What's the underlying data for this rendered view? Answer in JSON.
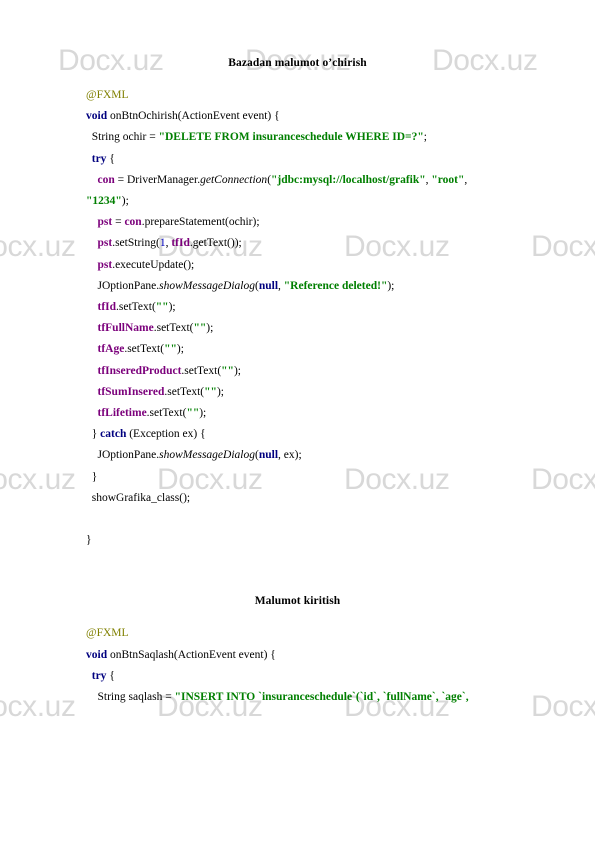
{
  "document": {
    "watermark_text": "Docx.uz",
    "watermark_color": "#d8d8d8",
    "colors": {
      "keyword": "#00007f",
      "annotation": "#808000",
      "string": "#007f00",
      "field": "#7b007b",
      "number": "#0000c0",
      "text": "#000000"
    }
  },
  "sections": [
    {
      "heading": "Bazadan malumot o’chirish",
      "lines": [
        {
          "indent": 0,
          "tokens": [
            {
              "t": "@FXML",
              "c": "anno"
            }
          ]
        },
        {
          "indent": 0,
          "tokens": [
            {
              "t": "void",
              "c": "kw"
            },
            {
              "t": " onBtnOchirish(ActionEvent event) {",
              "c": "pln"
            }
          ]
        },
        {
          "indent": 1,
          "tokens": [
            {
              "t": "String ochir = ",
              "c": "pln"
            },
            {
              "t": "\"DELETE FROM insuranceschedule WHERE ID=?\"",
              "c": "str"
            },
            {
              "t": ";",
              "c": "pln"
            }
          ]
        },
        {
          "indent": 1,
          "tokens": [
            {
              "t": "try",
              "c": "kw"
            },
            {
              "t": " {",
              "c": "pln"
            }
          ]
        },
        {
          "indent": 2,
          "tokens": [
            {
              "t": "con",
              "c": "fld"
            },
            {
              "t": " = DriverManager.",
              "c": "pln"
            },
            {
              "t": "getConnection",
              "c": "mth"
            },
            {
              "t": "(",
              "c": "pln"
            },
            {
              "t": "\"jdbc:mysql://localhost/grafik\"",
              "c": "str"
            },
            {
              "t": ", ",
              "c": "pln"
            },
            {
              "t": "\"root\"",
              "c": "str"
            },
            {
              "t": ",",
              "c": "pln"
            }
          ]
        },
        {
          "indent": 0,
          "tokens": [
            {
              "t": "\"1234\"",
              "c": "str"
            },
            {
              "t": ");",
              "c": "pln"
            }
          ]
        },
        {
          "indent": 2,
          "tokens": [
            {
              "t": "pst",
              "c": "fld"
            },
            {
              "t": " = ",
              "c": "pln"
            },
            {
              "t": "con",
              "c": "fld"
            },
            {
              "t": ".prepareStatement(ochir);",
              "c": "pln"
            }
          ]
        },
        {
          "indent": 2,
          "tokens": [
            {
              "t": "pst",
              "c": "fld"
            },
            {
              "t": ".setString(",
              "c": "pln"
            },
            {
              "t": "1",
              "c": "num"
            },
            {
              "t": ", ",
              "c": "pln"
            },
            {
              "t": "tfId",
              "c": "fld"
            },
            {
              "t": ".getText());",
              "c": "pln"
            }
          ]
        },
        {
          "indent": 2,
          "tokens": [
            {
              "t": "pst",
              "c": "fld"
            },
            {
              "t": ".executeUpdate();",
              "c": "pln"
            }
          ]
        },
        {
          "indent": 2,
          "tokens": [
            {
              "t": "JOptionPane.",
              "c": "pln"
            },
            {
              "t": "showMessageDialog",
              "c": "mth"
            },
            {
              "t": "(",
              "c": "pln"
            },
            {
              "t": "null",
              "c": "kw"
            },
            {
              "t": ", ",
              "c": "pln"
            },
            {
              "t": "\"Reference deleted!\"",
              "c": "str"
            },
            {
              "t": ");",
              "c": "pln"
            }
          ]
        },
        {
          "indent": 2,
          "tokens": [
            {
              "t": "tfId",
              "c": "fld"
            },
            {
              "t": ".setText(",
              "c": "pln"
            },
            {
              "t": "\"\"",
              "c": "str"
            },
            {
              "t": ");",
              "c": "pln"
            }
          ]
        },
        {
          "indent": 2,
          "tokens": [
            {
              "t": "tfFullName",
              "c": "fld"
            },
            {
              "t": ".setText(",
              "c": "pln"
            },
            {
              "t": "\"\"",
              "c": "str"
            },
            {
              "t": ");",
              "c": "pln"
            }
          ]
        },
        {
          "indent": 2,
          "tokens": [
            {
              "t": "tfAge",
              "c": "fld"
            },
            {
              "t": ".setText(",
              "c": "pln"
            },
            {
              "t": "\"\"",
              "c": "str"
            },
            {
              "t": ");",
              "c": "pln"
            }
          ]
        },
        {
          "indent": 2,
          "tokens": [
            {
              "t": "tfInseredProduct",
              "c": "fld"
            },
            {
              "t": ".setText(",
              "c": "pln"
            },
            {
              "t": "\"\"",
              "c": "str"
            },
            {
              "t": ");",
              "c": "pln"
            }
          ]
        },
        {
          "indent": 2,
          "tokens": [
            {
              "t": "tfSumInsered",
              "c": "fld"
            },
            {
              "t": ".setText(",
              "c": "pln"
            },
            {
              "t": "\"\"",
              "c": "str"
            },
            {
              "t": ");",
              "c": "pln"
            }
          ]
        },
        {
          "indent": 2,
          "tokens": [
            {
              "t": "tfLifetime",
              "c": "fld"
            },
            {
              "t": ".setText(",
              "c": "pln"
            },
            {
              "t": "\"\"",
              "c": "str"
            },
            {
              "t": ");",
              "c": "pln"
            }
          ]
        },
        {
          "indent": 1,
          "tokens": [
            {
              "t": "} ",
              "c": "pln"
            },
            {
              "t": "catch",
              "c": "kw"
            },
            {
              "t": " (Exception ex) {",
              "c": "pln"
            }
          ]
        },
        {
          "indent": 2,
          "tokens": [
            {
              "t": "JOptionPane.",
              "c": "pln"
            },
            {
              "t": "showMessageDialog",
              "c": "mth"
            },
            {
              "t": "(",
              "c": "pln"
            },
            {
              "t": "null",
              "c": "kw"
            },
            {
              "t": ", ex);",
              "c": "pln"
            }
          ]
        },
        {
          "indent": 1,
          "tokens": [
            {
              "t": "}",
              "c": "pln"
            }
          ]
        },
        {
          "indent": 1,
          "tokens": [
            {
              "t": "showGrafika_class();",
              "c": "pln"
            }
          ]
        },
        {
          "indent": 0,
          "tokens": []
        },
        {
          "indent": 0,
          "tokens": [
            {
              "t": "}",
              "c": "pln"
            }
          ]
        }
      ]
    },
    {
      "heading": "Malumot kiritish",
      "lines": [
        {
          "indent": 0,
          "tokens": [
            {
              "t": "@FXML",
              "c": "anno"
            }
          ]
        },
        {
          "indent": 0,
          "tokens": [
            {
              "t": "void",
              "c": "kw"
            },
            {
              "t": " onBtnSaqlash(ActionEvent event) {",
              "c": "pln"
            }
          ]
        },
        {
          "indent": 1,
          "tokens": [
            {
              "t": "try",
              "c": "kw"
            },
            {
              "t": " {",
              "c": "pln"
            }
          ]
        },
        {
          "indent": 2,
          "tokens": [
            {
              "t": "String saqlash = ",
              "c": "pln"
            },
            {
              "t": "\"INSERT INTO `insuranceschedule`(`id`, `fullName`, `age`,",
              "c": "str"
            }
          ]
        }
      ]
    }
  ]
}
